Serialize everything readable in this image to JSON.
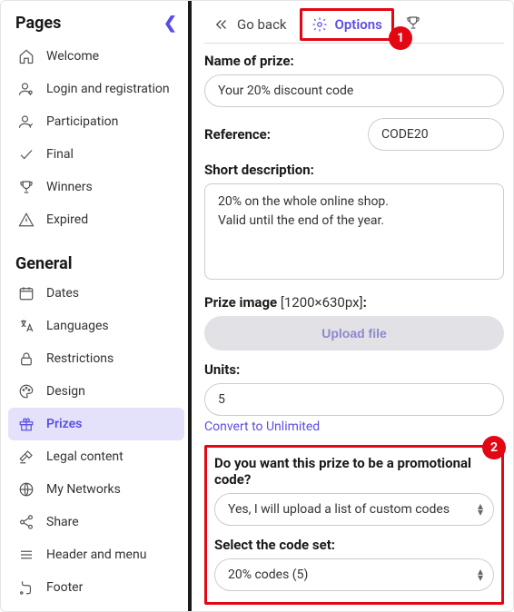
{
  "sidebar": {
    "header": "Pages",
    "general_header": "General",
    "pages": [
      {
        "label": "Welcome"
      },
      {
        "label": "Login and registration"
      },
      {
        "label": "Participation"
      },
      {
        "label": "Final"
      },
      {
        "label": "Winners"
      },
      {
        "label": "Expired"
      }
    ],
    "general": [
      {
        "label": "Dates"
      },
      {
        "label": "Languages"
      },
      {
        "label": "Restrictions"
      },
      {
        "label": "Design"
      },
      {
        "label": "Prizes"
      },
      {
        "label": "Legal content"
      },
      {
        "label": "My Networks"
      },
      {
        "label": "Share"
      },
      {
        "label": "Header and menu"
      },
      {
        "label": "Footer"
      }
    ]
  },
  "topbar": {
    "go_back": "Go back",
    "options": "Options"
  },
  "annotations": {
    "badge1": "1",
    "badge2": "2"
  },
  "form": {
    "name_label": "Name of prize:",
    "name_value": "Your 20% discount code",
    "reference_label": "Reference:",
    "reference_value": "CODE20",
    "short_desc_label": "Short description:",
    "short_desc_value": "20% on the whole online shop.\nValid until the end of the year.",
    "prize_image_label": "Prize image",
    "prize_image_dim": " [1200×630px]",
    "prize_image_colon": ":",
    "upload_label": "Upload file",
    "units_label": "Units:",
    "units_value": "5",
    "convert_link": "Convert to Unlimited",
    "promo_question": "Do you want this prize to be a promotional code?",
    "promo_value": "Yes, I will upload a list of custom codes",
    "codeset_label": "Select the code set:",
    "codeset_value": "20% codes (5)"
  }
}
